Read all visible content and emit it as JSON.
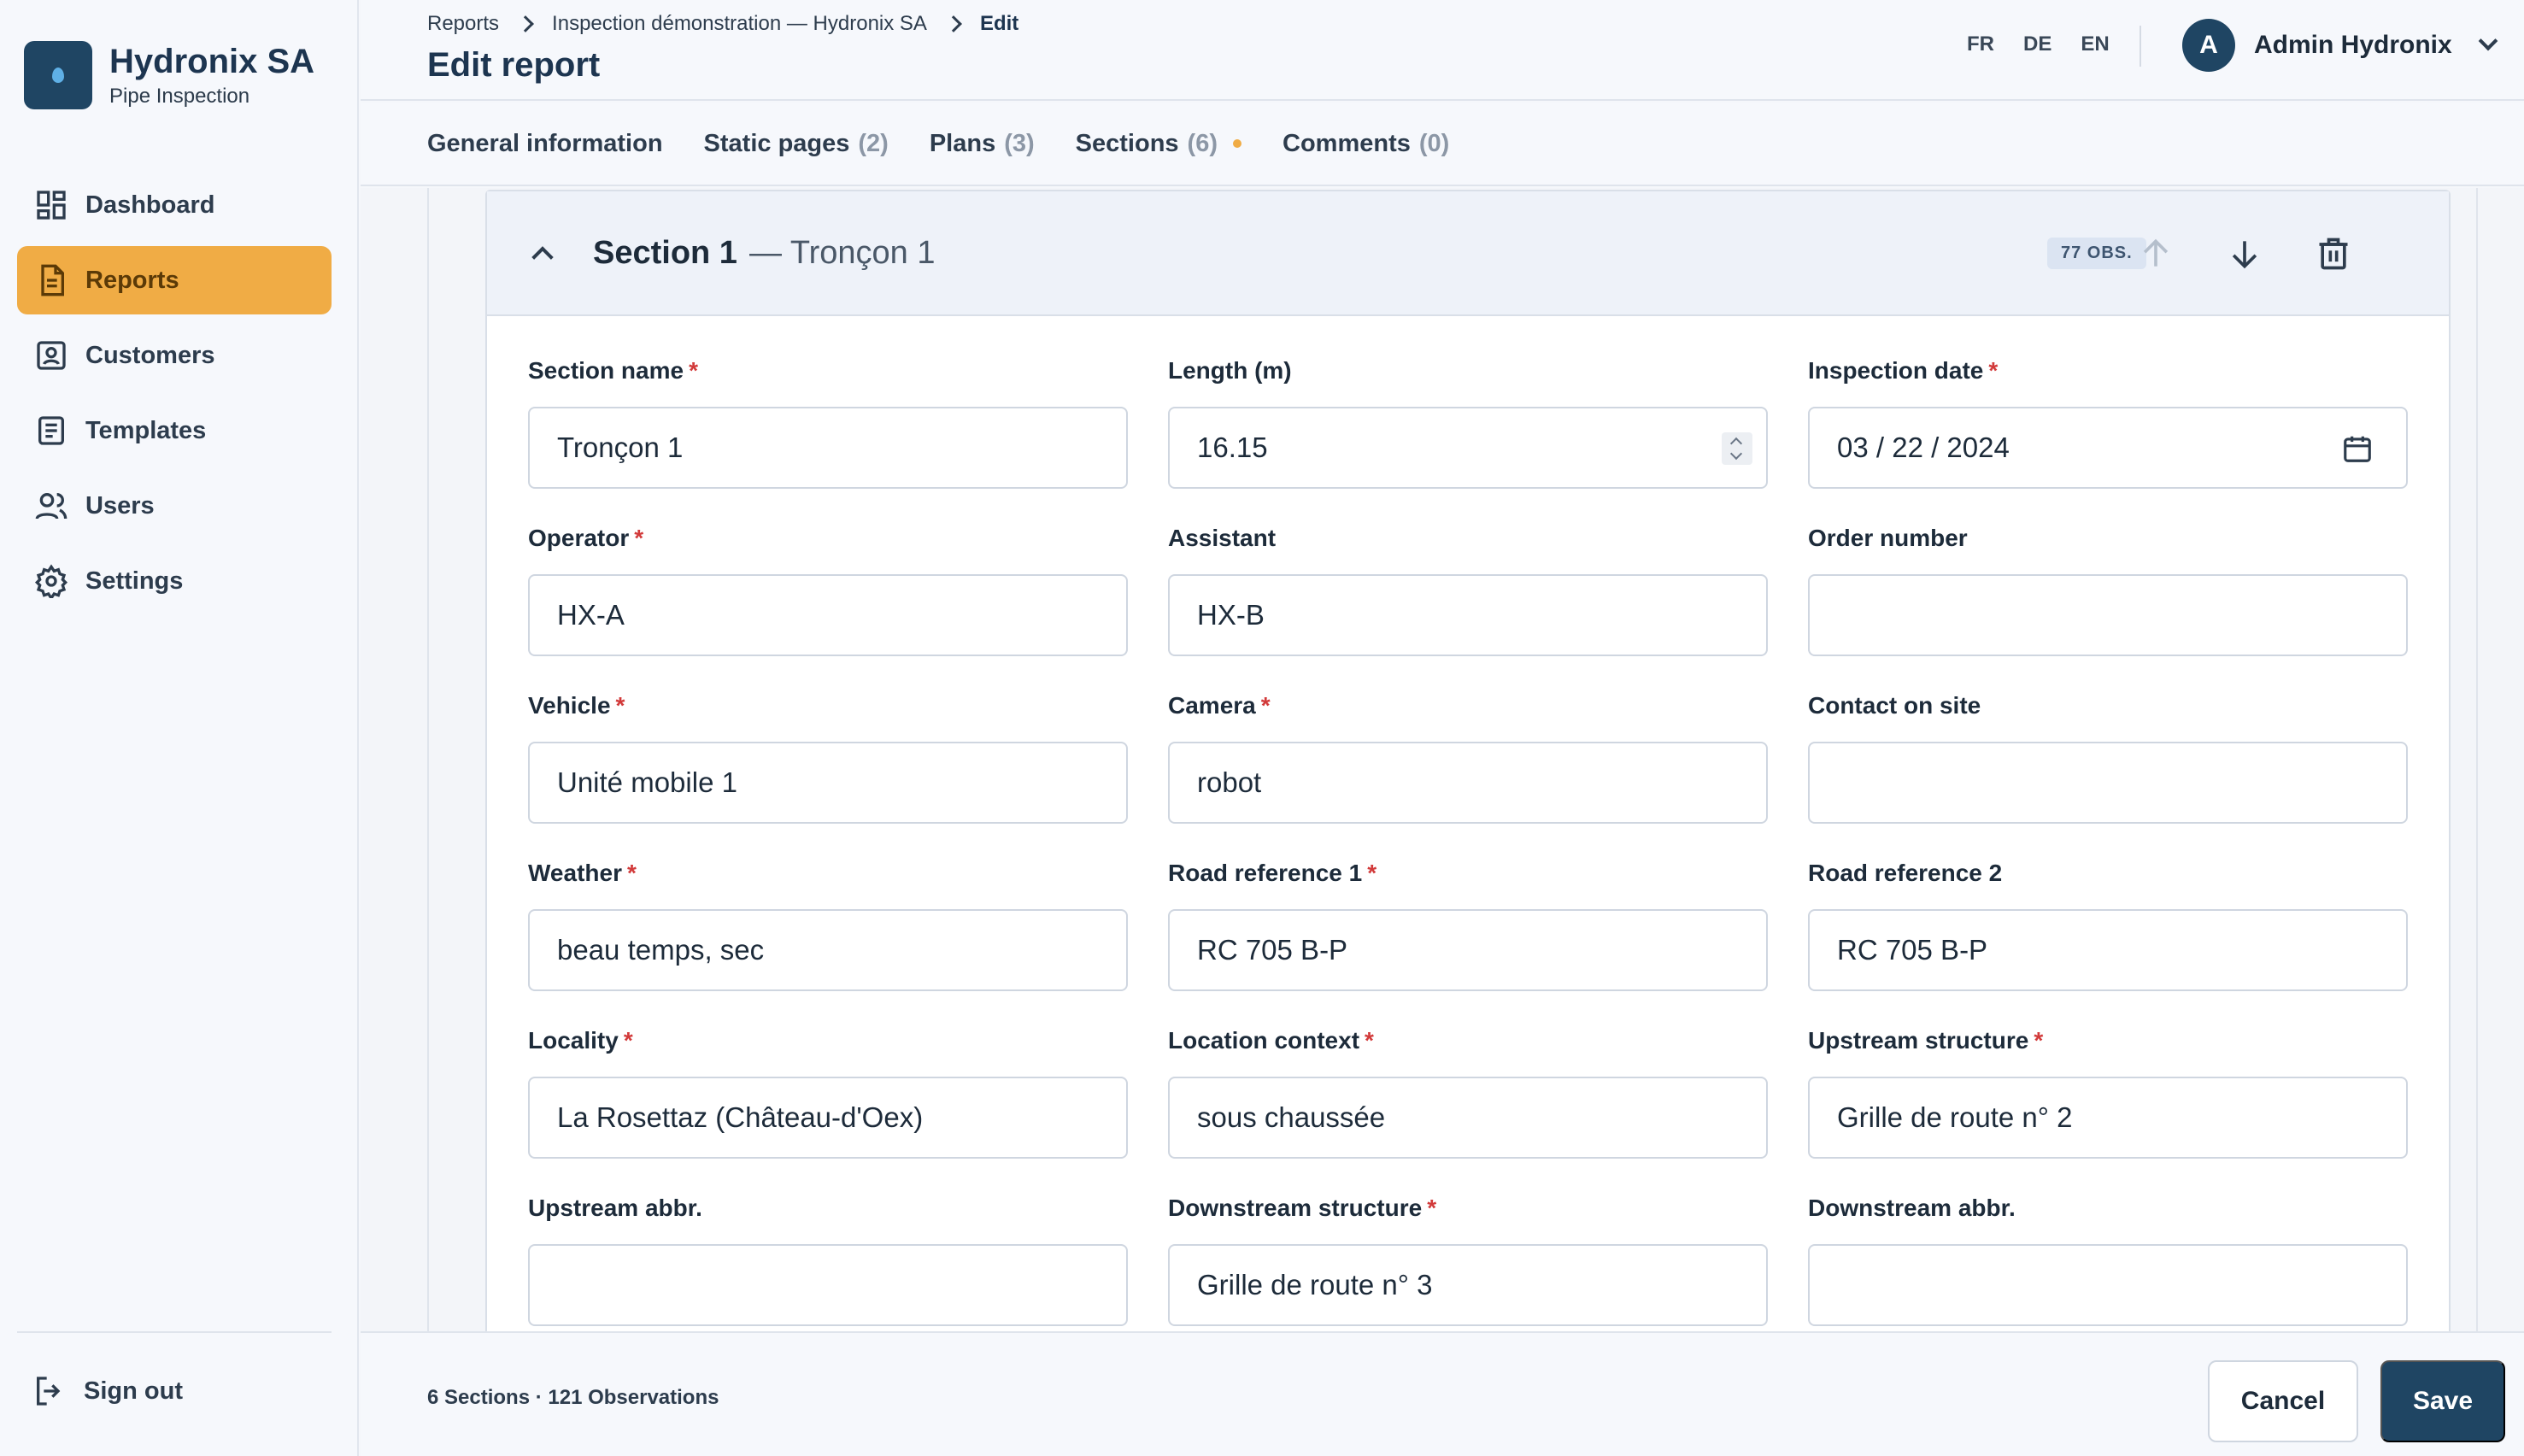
{
  "brand": {
    "name": "Hydronix SA",
    "subtitle": "Pipe Inspection"
  },
  "sidebar": {
    "items": [
      {
        "label": "Dashboard",
        "icon": "dashboard-icon",
        "active": false
      },
      {
        "label": "Reports",
        "icon": "report-icon",
        "active": true
      },
      {
        "label": "Customers",
        "icon": "customers-icon",
        "active": false
      },
      {
        "label": "Templates",
        "icon": "templates-icon",
        "active": false
      },
      {
        "label": "Users",
        "icon": "users-icon",
        "active": false
      },
      {
        "label": "Settings",
        "icon": "gear-icon",
        "active": false
      }
    ],
    "signout": "Sign out"
  },
  "header": {
    "breadcrumb": [
      "Reports",
      "Inspection démonstration — Hydronix SA",
      "Edit"
    ],
    "title": "Edit report",
    "languages": [
      "FR",
      "DE",
      "EN"
    ],
    "user": {
      "initial": "A",
      "name": "Admin Hydronix"
    }
  },
  "tabs": [
    {
      "label": "General information",
      "count": ""
    },
    {
      "label": "Static pages",
      "count": "(2)"
    },
    {
      "label": "Plans",
      "count": "(3)"
    },
    {
      "label": "Sections",
      "count": "(6)",
      "dot": true
    },
    {
      "label": "Comments",
      "count": "(0)"
    }
  ],
  "section": {
    "title": "Section 1",
    "subtitle": "— Tronçon 1",
    "badge": "77 OBS."
  },
  "fields": {
    "section_name": {
      "label": "Section name",
      "value": "Tronçon 1",
      "required": true
    },
    "length": {
      "label": "Length (m)",
      "value": "16.15",
      "required": false
    },
    "inspection_date": {
      "label": "Inspection date",
      "value": "03 / 22 / 2024",
      "required": true
    },
    "operator": {
      "label": "Operator",
      "value": "HX-A",
      "required": true
    },
    "assistant": {
      "label": "Assistant",
      "value": "HX-B",
      "required": false
    },
    "order_number": {
      "label": "Order number",
      "value": "",
      "required": false
    },
    "vehicle": {
      "label": "Vehicle",
      "value": "Unité mobile 1",
      "required": true
    },
    "camera": {
      "label": "Camera",
      "value": "robot",
      "required": true
    },
    "contact": {
      "label": "Contact on site",
      "value": "",
      "required": false
    },
    "weather": {
      "label": "Weather",
      "value": "beau temps, sec",
      "required": true
    },
    "road_ref_1": {
      "label": "Road reference 1",
      "value": "RC 705 B-P",
      "required": true
    },
    "road_ref_2": {
      "label": "Road reference 2",
      "value": "RC 705 B-P",
      "required": false
    },
    "locality": {
      "label": "Locality",
      "value": "La Rosettaz (Château-d'Oex)",
      "required": true
    },
    "location_context": {
      "label": "Location context",
      "value": "sous chaussée",
      "required": true
    },
    "upstream_structure": {
      "label": "Upstream structure",
      "value": "Grille de route n° 2",
      "required": true
    },
    "upstream_abbr": {
      "label": "Upstream abbr.",
      "value": "",
      "required": false
    },
    "downstream_structure": {
      "label": "Downstream structure",
      "value": "Grille de route n° 3",
      "required": true
    },
    "downstream_abbr": {
      "label": "Downstream abbr.",
      "value": "",
      "required": false
    }
  },
  "footer": {
    "summary": "6 Sections · 121 Observations",
    "cancel": "Cancel",
    "save": "Save"
  },
  "colors": {
    "accent": "#f0ac45",
    "primary": "#1f4563",
    "required": "#d23a3a"
  }
}
